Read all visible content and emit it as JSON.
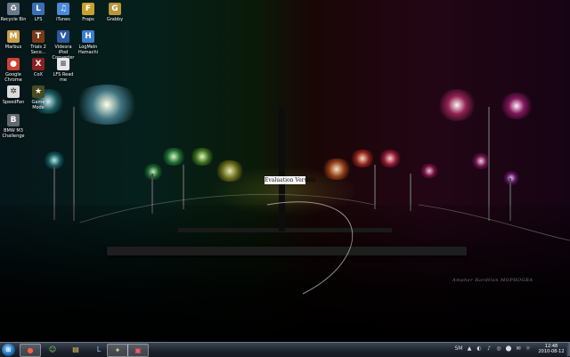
{
  "desktop": {
    "icons": [
      {
        "name": "recycle-bin-icon",
        "label": "Recycle Bin",
        "glyph": "♻",
        "bg": "#6a7a8a"
      },
      {
        "name": "lfs-icon",
        "label": "LFS",
        "glyph": "L",
        "bg": "#3a6fb5"
      },
      {
        "name": "itunes-icon",
        "label": "iTunes",
        "glyph": "♫",
        "bg": "#4a8ad8"
      },
      {
        "name": "fraps-icon",
        "label": "Fraps",
        "glyph": "F",
        "bg": "#c8a030"
      },
      {
        "name": "grabby-icon",
        "label": "Grabby",
        "glyph": "G",
        "bg": "#b8953a"
      },
      {
        "name": "marbus-icon",
        "label": "Marbus",
        "glyph": "M",
        "bg": "#c9a04a"
      },
      {
        "name": "trials-icon",
        "label": "Trials 2 Seco...",
        "glyph": "T",
        "bg": "#7a3a1a"
      },
      {
        "name": "videora-icon",
        "label": "Videora iPod Converter",
        "glyph": "V",
        "bg": "#2a5aa0"
      },
      {
        "name": "hamachi-icon",
        "label": "LogMeIn Hamachi",
        "glyph": "H",
        "bg": "#3a7fd0"
      },
      {
        "name": "chrome-icon",
        "label": "Google Chrome",
        "glyph": "●",
        "bg": "#d04030"
      },
      {
        "name": "cod-icon",
        "label": "CoX",
        "glyph": "X",
        "bg": "#8a2020"
      },
      {
        "name": "lfs-readme-icon",
        "label": "LFS Read me",
        "glyph": "≡",
        "bg": "#e8e8e8"
      },
      {
        "name": "speedfan-icon",
        "label": "SpeedFan",
        "glyph": "✲",
        "bg": "#dcdcdc"
      },
      {
        "name": "game-icon",
        "label": "Game Mode",
        "glyph": "★",
        "bg": "#4a4a20"
      },
      {
        "name": "bmw-icon",
        "label": "BMW M3 Challenge",
        "glyph": "B",
        "bg": "#606870"
      }
    ],
    "watermark": "Evaluation Version",
    "signature": "Ampher Hardtlen  MOPHOGRA"
  },
  "taskbar": {
    "start_glyph": "⊞",
    "buttons": [
      {
        "name": "chrome-taskbar-button",
        "glyph": "●",
        "color": "#ff6040",
        "active": true
      },
      {
        "name": "messenger-taskbar-button",
        "glyph": "☺",
        "color": "#8fd06a",
        "active": false
      },
      {
        "name": "explorer-taskbar-button",
        "glyph": "▤",
        "color": "#e8c860",
        "active": false
      },
      {
        "name": "lfs-taskbar-button",
        "glyph": "L",
        "color": "#9ac4ff",
        "active": false
      },
      {
        "name": "game-taskbar-button",
        "glyph": "✦",
        "color": "#e0d080",
        "active": true
      },
      {
        "name": "media-taskbar-button",
        "glyph": "▣",
        "color": "#ff5a5a",
        "active": true
      }
    ],
    "tray": {
      "lang": "SM",
      "icons": [
        "▲",
        "◐",
        "♪",
        "◎",
        "⬤",
        "✉",
        "☼"
      ],
      "time": "12:48",
      "date": "2010-08-12"
    }
  }
}
